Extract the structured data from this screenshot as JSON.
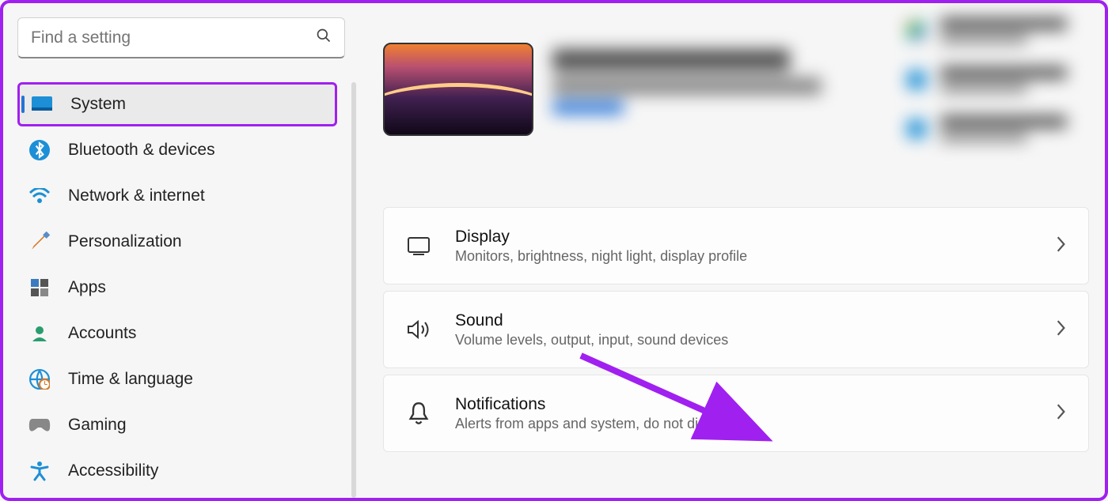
{
  "search": {
    "placeholder": "Find a setting"
  },
  "sidebar": {
    "items": [
      {
        "label": "System",
        "active": true
      },
      {
        "label": "Bluetooth & devices",
        "active": false
      },
      {
        "label": "Network & internet",
        "active": false
      },
      {
        "label": "Personalization",
        "active": false
      },
      {
        "label": "Apps",
        "active": false
      },
      {
        "label": "Accounts",
        "active": false
      },
      {
        "label": "Time & language",
        "active": false
      },
      {
        "label": "Gaming",
        "active": false
      },
      {
        "label": "Accessibility",
        "active": false
      }
    ]
  },
  "main": {
    "settings": [
      {
        "title": "Display",
        "sub": "Monitors, brightness, night light, display profile"
      },
      {
        "title": "Sound",
        "sub": "Volume levels, output, input, sound devices"
      },
      {
        "title": "Notifications",
        "sub": "Alerts from apps and system, do not disturb"
      }
    ]
  },
  "annotation": {
    "highlight_color": "#a020f0"
  }
}
